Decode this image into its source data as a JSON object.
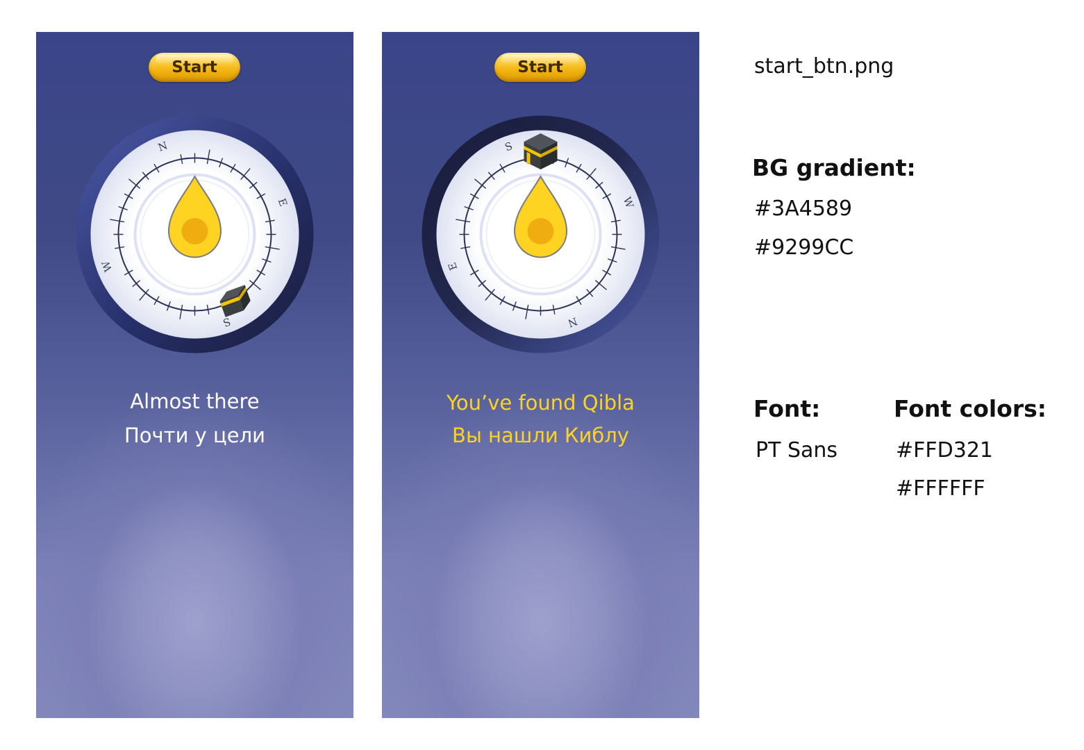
{
  "left_screen": {
    "start_label": "Start",
    "status_line1": "Almost there",
    "status_line2": "Почти у цели",
    "compass_labels": {
      "n": "N",
      "e": "E",
      "s": "S",
      "w": "W"
    },
    "compass_rotation_deg": -20
  },
  "right_screen": {
    "start_label": "Start",
    "status_line1": "You’ve found Qibla",
    "status_line2": "Вы нашли Киблу",
    "compass_labels": {
      "n": "N",
      "e": "E",
      "s": "S",
      "w": "W"
    },
    "compass_rotation_deg": 160
  },
  "spec": {
    "filename": "start_btn.png",
    "bg_gradient_title": "BG gradient:",
    "bg_gradient_colors": [
      "#3A4589",
      "#9299CC"
    ],
    "font_title": "Font:",
    "font_name": "PT Sans",
    "font_colors_title": "Font colors:",
    "font_colors": [
      "#FFD321",
      "#FFFFFF"
    ]
  },
  "colors": {
    "bg_top": "#3A4589",
    "bg_glow": "#9299CC",
    "text_yellow": "#FFD321",
    "text_white": "#FFFFFF"
  },
  "icons": {
    "needle": "teardrop-needle-icon",
    "kaaba": "kaaba-icon"
  }
}
